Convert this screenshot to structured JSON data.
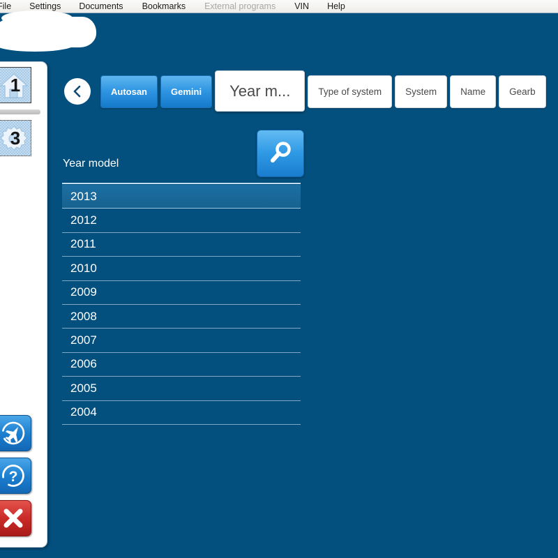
{
  "menu": {
    "items": [
      {
        "label": "File",
        "disabled": false
      },
      {
        "label": "Settings",
        "disabled": false
      },
      {
        "label": "Documents",
        "disabled": false
      },
      {
        "label": "Bookmarks",
        "disabled": false
      },
      {
        "label": "External programs",
        "disabled": true
      },
      {
        "label": "VIN",
        "disabled": false
      },
      {
        "label": "Help",
        "disabled": false
      }
    ]
  },
  "sidebar": {
    "top_items": [
      {
        "number": "1",
        "icon": "home-icon"
      },
      {
        "number": "3",
        "icon": "gear-icon"
      }
    ],
    "bottom_items": [
      {
        "icon": "airplane-globe-icon",
        "color": "#1b7fd0"
      },
      {
        "icon": "question-mark-icon",
        "color": "#1b7fd0"
      },
      {
        "icon": "close-x-icon",
        "color": "#c92a27"
      }
    ]
  },
  "navigation": {
    "back_label": "‹",
    "tabs": [
      {
        "label": "Autosan",
        "state": "crumb"
      },
      {
        "label": "Gemini",
        "state": "crumb"
      },
      {
        "label": "Year m...",
        "state": "active"
      },
      {
        "label": "Type of system",
        "state": "plain"
      },
      {
        "label": "System",
        "state": "plain"
      },
      {
        "label": "Name",
        "state": "plain"
      },
      {
        "label": "Gearb",
        "state": "plain"
      }
    ]
  },
  "main": {
    "search_icon": "magnifier-icon",
    "column_header": "Year model",
    "rows": [
      {
        "value": "2013",
        "selected": true
      },
      {
        "value": "2012",
        "selected": false
      },
      {
        "value": "2011",
        "selected": false
      },
      {
        "value": "2010",
        "selected": false
      },
      {
        "value": "2009",
        "selected": false
      },
      {
        "value": "2008",
        "selected": false
      },
      {
        "value": "2007",
        "selected": false
      },
      {
        "value": "2006",
        "selected": false
      },
      {
        "value": "2005",
        "selected": false
      },
      {
        "value": "2004",
        "selected": false
      }
    ]
  },
  "colors": {
    "background": "#03507f",
    "accent_blue": "#2e95e2",
    "selected_row": "#1c6fa3",
    "danger_red": "#c92a27",
    "panel_white": "#ffffff"
  }
}
